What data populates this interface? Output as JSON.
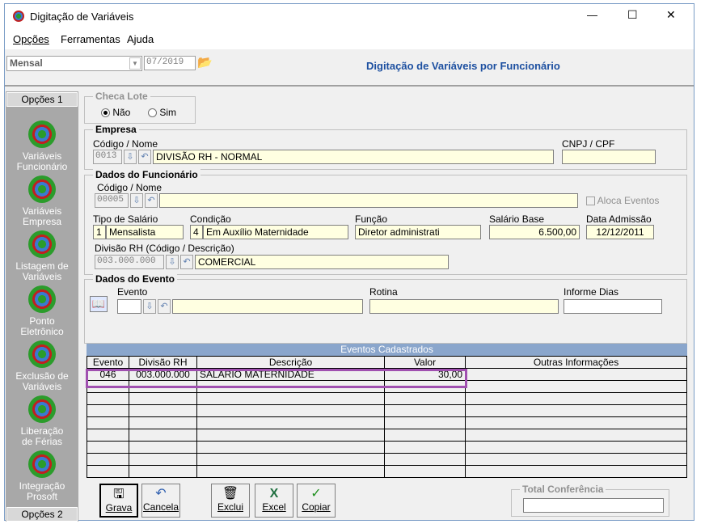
{
  "window": {
    "title": "Digitação de Variáveis",
    "controls": {
      "minimize": "—",
      "maximize": "☐",
      "close": "✕"
    }
  },
  "menu": [
    "Opções",
    "Ferramentas",
    "Ajuda"
  ],
  "toolbar": {
    "period_type": "Mensal",
    "period": "07/2019",
    "heading": "Digitação de Variáveis por Funcionário"
  },
  "sidebar": {
    "top_label": "Opções 1",
    "bottom_label": "Opções 2",
    "items": [
      {
        "line1": "Variáveis",
        "line2": "Funcionário"
      },
      {
        "line1": "Variáveis",
        "line2": "Empresa"
      },
      {
        "line1": "Listagem de",
        "line2": "Variáveis"
      },
      {
        "line1": "Ponto",
        "line2": "Eletrônico"
      },
      {
        "line1": "Exclusão de",
        "line2": "Variáveis"
      },
      {
        "line1": "Liberação",
        "line2": "de Férias"
      },
      {
        "line1": "Integração",
        "line2": "Prosoft"
      }
    ]
  },
  "checa_lote": {
    "title": "Checa Lote",
    "opt_no": "Não",
    "opt_yes": "Sim"
  },
  "empresa": {
    "title": "Empresa",
    "code_label": "Código / Nome",
    "code": "0013",
    "name": "DIVISÃO RH - NORMAL",
    "cnpj_label": "CNPJ / CPF",
    "cnpj": ""
  },
  "funcionario": {
    "title": "Dados do Funcionário",
    "code_label": "Código / Nome",
    "code": "00005",
    "name": "",
    "aloca_label": "Aloca Eventos",
    "tipo_label": "Tipo de Salário",
    "tipo_code": "1",
    "tipo_value": "Mensalista",
    "condicao_label": "Condição",
    "condicao_code": "4",
    "condicao_value": "Em Auxílio Maternidade",
    "funcao_label": "Função",
    "funcao_value": "Diretor administrati",
    "salario_label": "Salário Base",
    "salario_value": "6.500,00",
    "admissao_label": "Data Admissão",
    "admissao_value": "12/12/2011",
    "divisao_label": "Divisão RH (Código / Descrição)",
    "divisao_code": "003.000.000",
    "divisao_value": "COMERCIAL"
  },
  "evento": {
    "title": "Dados do Evento",
    "evento_label": "Evento",
    "rotina_label": "Rotina",
    "informe_label": "Informe Dias"
  },
  "grid": {
    "title": "Eventos Cadastrados",
    "columns": [
      "Evento",
      "Divisão RH",
      "Descrição",
      "Valor",
      "Outras Informações"
    ],
    "rows": [
      {
        "evento": "046",
        "divisao": "003.000.000",
        "descricao": "SALÁRIO MATERNIDADE",
        "valor": "30,00",
        "outras": ""
      }
    ],
    "highlight_color": "#a050b0"
  },
  "buttons": {
    "grava": "Grava",
    "cancela": "Cancela",
    "exclui": "Exclui",
    "excel": "Excel",
    "copiar": "Copiar"
  },
  "total": {
    "title": "Total Conferência",
    "value": ""
  }
}
